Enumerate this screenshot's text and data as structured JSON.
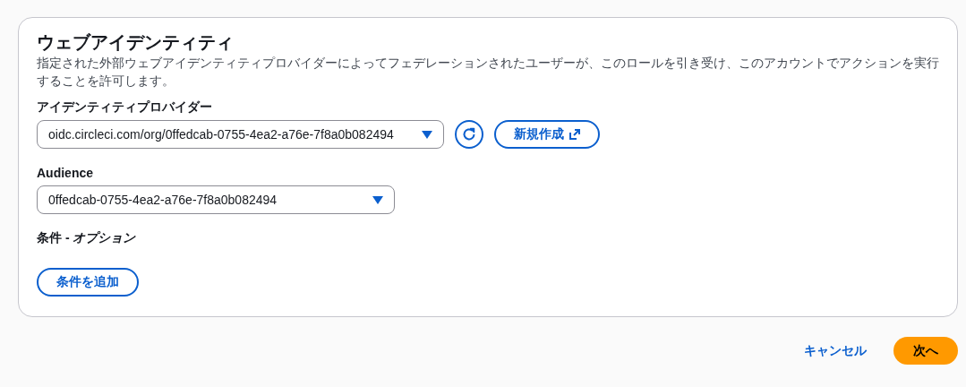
{
  "panel": {
    "title": "ウェブアイデンティティ",
    "description": "指定された外部ウェブアイデンティティプロバイダーによってフェデレーションされたユーザーが、このロールを引き受け、このアカウントでアクションを実行することを許可します。",
    "identity_provider": {
      "label": "アイデンティティプロバイダー",
      "value": "oidc.circleci.com/org/0ffedcab-0755-4ea2-a76e-7f8a0b082494",
      "create_button": "新規作成"
    },
    "audience": {
      "label": "Audience",
      "value": "0ffedcab-0755-4ea2-a76e-7f8a0b082494"
    },
    "conditions": {
      "label": "条件 - *オプション*",
      "add_button": "条件を追加"
    }
  },
  "footer": {
    "cancel": "キャンセル",
    "next": "次へ"
  }
}
